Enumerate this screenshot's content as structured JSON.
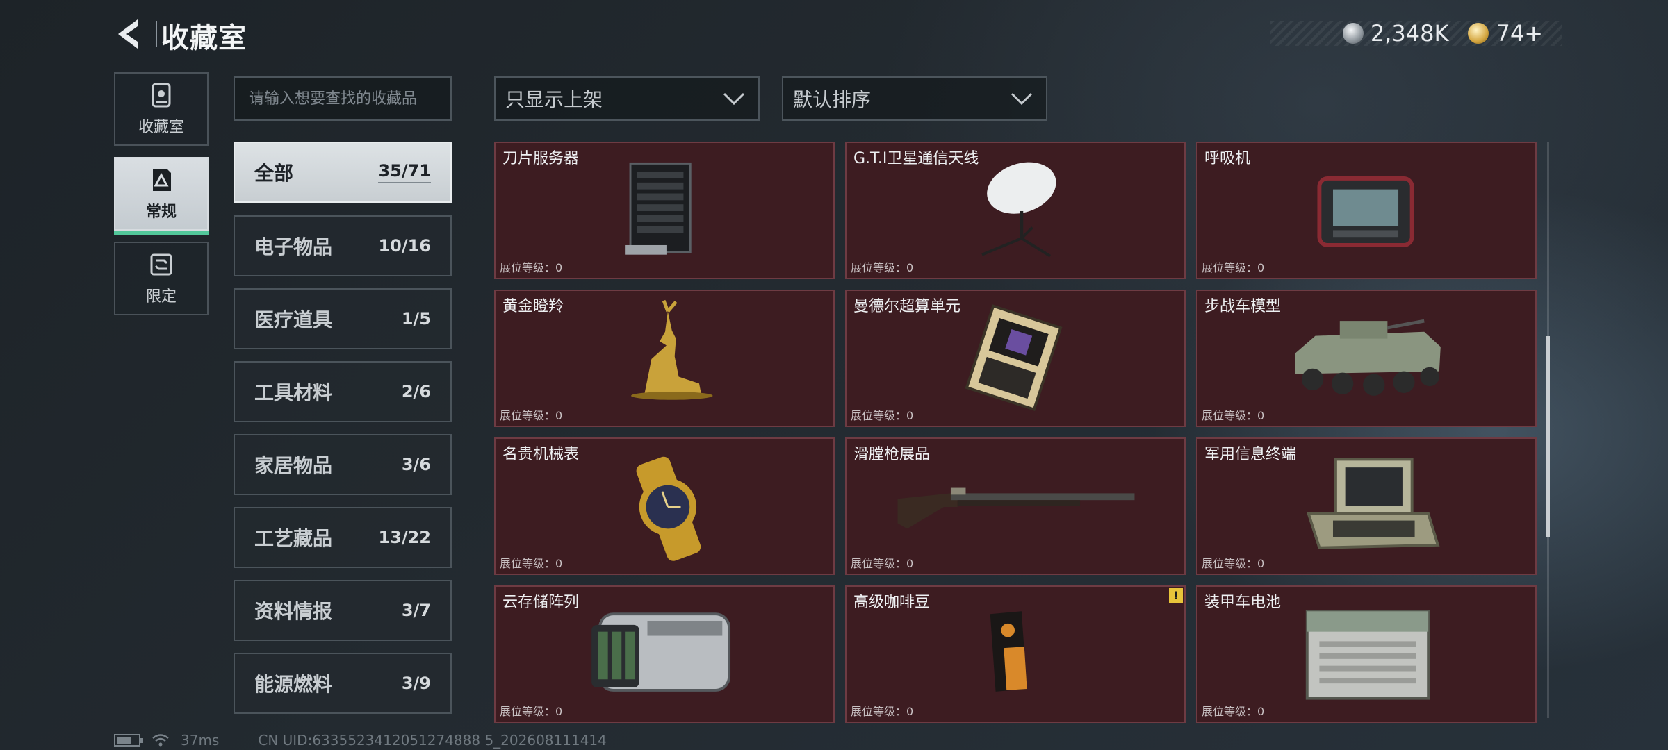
{
  "header": {
    "title": "收藏室",
    "currencies": [
      {
        "icon": "silver-coin-icon",
        "value": "2,348K"
      },
      {
        "icon": "gold-coin-icon",
        "value": "74+"
      }
    ]
  },
  "rail": [
    {
      "label": "收藏室",
      "icon": "collection-room-icon",
      "active": false
    },
    {
      "label": "常规",
      "icon": "regular-icon",
      "active": true
    },
    {
      "label": "限定",
      "icon": "limited-icon",
      "active": false
    }
  ],
  "search": {
    "placeholder": "请输入想要查找的收藏品"
  },
  "categories": [
    {
      "name": "全部",
      "count": "35/71",
      "active": true
    },
    {
      "name": "电子物品",
      "count": "10/16"
    },
    {
      "name": "医疗道具",
      "count": "1/5"
    },
    {
      "name": "工具材料",
      "count": "2/6"
    },
    {
      "name": "家居物品",
      "count": "3/6"
    },
    {
      "name": "工艺藏品",
      "count": "13/22"
    },
    {
      "name": "资料情报",
      "count": "3/7"
    },
    {
      "name": "能源燃料",
      "count": "3/9"
    }
  ],
  "filters": {
    "show_filter": "只显示上架",
    "sort": "默认排序"
  },
  "items": [
    {
      "name": "刀片服务器",
      "level": "展位等级：0",
      "icon": "blade-server-icon"
    },
    {
      "name": "G.T.I卫星通信天线",
      "level": "展位等级：0",
      "icon": "satellite-antenna-icon"
    },
    {
      "name": "呼吸机",
      "level": "展位等级：0",
      "icon": "ventilator-icon"
    },
    {
      "name": "黄金瞪羚",
      "level": "展位等级：0",
      "icon": "golden-gazelle-icon"
    },
    {
      "name": "曼德尔超算单元",
      "level": "展位等级：0",
      "icon": "supercomputer-unit-icon"
    },
    {
      "name": "步战车模型",
      "level": "展位等级：0",
      "icon": "ifv-model-icon"
    },
    {
      "name": "名贵机械表",
      "level": "展位等级：0",
      "icon": "luxury-watch-icon"
    },
    {
      "name": "滑膛枪展品",
      "level": "展位等级：0",
      "icon": "musket-icon"
    },
    {
      "name": "军用信息终端",
      "level": "展位等级：0",
      "icon": "military-terminal-icon"
    },
    {
      "name": "云存储阵列",
      "level": "展位等级：0",
      "icon": "cloud-storage-array-icon"
    },
    {
      "name": "高级咖啡豆",
      "level": "展位等级：0",
      "icon": "coffee-beans-icon",
      "warning": "!"
    },
    {
      "name": "装甲车电池",
      "level": "展位等级：0",
      "icon": "armored-battery-icon"
    }
  ],
  "status": {
    "ping": "37ms",
    "uid": "CN UID:6335523412051274888 5_202608111414"
  },
  "colors": {
    "card_bg": "#3d1c21",
    "active_accent": "#52c79a",
    "warning": "#e8c43a"
  }
}
